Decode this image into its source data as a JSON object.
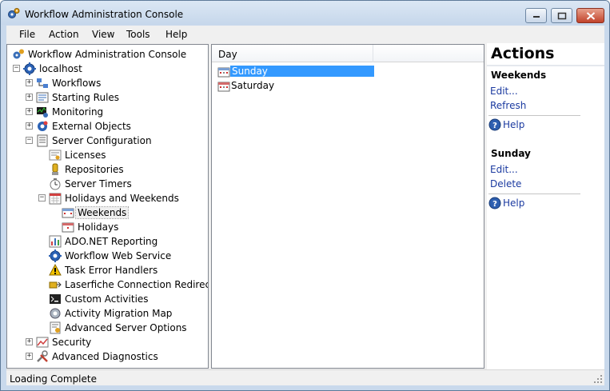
{
  "window": {
    "title": "Workflow Administration Console"
  },
  "menu": [
    "File",
    "Action",
    "View",
    "Tools",
    "Help"
  ],
  "tree": [
    {
      "label": "Workflow Administration Console",
      "icon": "console-icon",
      "level": 0,
      "expander": ""
    },
    {
      "label": "localhost",
      "icon": "server-gear-icon",
      "level": 1,
      "expander": "-"
    },
    {
      "label": "Workflows",
      "icon": "workflows-icon",
      "level": 2,
      "expander": "+"
    },
    {
      "label": "Starting Rules",
      "icon": "starting-rules-icon",
      "level": 2,
      "expander": "+"
    },
    {
      "label": "Monitoring",
      "icon": "monitoring-icon",
      "level": 2,
      "expander": "+"
    },
    {
      "label": "External Objects",
      "icon": "external-objects-icon",
      "level": 2,
      "expander": "+"
    },
    {
      "label": "Server Configuration",
      "icon": "server-configuration-icon",
      "level": 2,
      "expander": "-"
    },
    {
      "label": "Licenses",
      "icon": "licenses-icon",
      "level": 3,
      "expander": ""
    },
    {
      "label": "Repositories",
      "icon": "repositories-icon",
      "level": 3,
      "expander": ""
    },
    {
      "label": "Server Timers",
      "icon": "timer-icon",
      "level": 3,
      "expander": ""
    },
    {
      "label": "Holidays and Weekends",
      "icon": "calendar-icon",
      "level": 3,
      "expander": "-"
    },
    {
      "label": "Weekends",
      "icon": "weekends-icon",
      "level": 4,
      "expander": "",
      "selected": true
    },
    {
      "label": "Holidays",
      "icon": "holidays-icon",
      "level": 4,
      "expander": ""
    },
    {
      "label": "ADO.NET Reporting",
      "icon": "reporting-icon",
      "level": 3,
      "expander": ""
    },
    {
      "label": "Workflow Web Service",
      "icon": "web-service-gear-icon",
      "level": 3,
      "expander": ""
    },
    {
      "label": "Task Error Handlers",
      "icon": "warning-icon",
      "level": 3,
      "expander": ""
    },
    {
      "label": "Laserfiche Connection Redirects",
      "icon": "connection-redirect-icon",
      "level": 3,
      "expander": ""
    },
    {
      "label": "Custom Activities",
      "icon": "custom-activities-icon",
      "level": 3,
      "expander": ""
    },
    {
      "label": "Activity Migration Map",
      "icon": "migration-gear-icon",
      "level": 3,
      "expander": ""
    },
    {
      "label": "Advanced Server Options",
      "icon": "advanced-options-icon",
      "level": 3,
      "expander": ""
    },
    {
      "label": "Security",
      "icon": "security-icon",
      "level": 2,
      "expander": "+"
    },
    {
      "label": "Advanced Diagnostics",
      "icon": "diagnostics-tools-icon",
      "level": 2,
      "expander": "+"
    }
  ],
  "list": {
    "column_header": "Day",
    "rows": [
      {
        "label": "Sunday",
        "selected": true
      },
      {
        "label": "Saturday",
        "selected": false
      }
    ]
  },
  "actions": {
    "title": "Actions",
    "sections": [
      {
        "heading": "Weekends",
        "links": [
          "Edit...",
          "Refresh"
        ],
        "help": "Help"
      },
      {
        "heading": "Sunday",
        "links": [
          "Edit...",
          "Delete"
        ],
        "help": "Help"
      }
    ]
  },
  "status": {
    "text": "Loading Complete"
  },
  "colors": {
    "selection": "#3399ff",
    "link": "#1b3aa0",
    "frame": "#c9d9ec"
  }
}
